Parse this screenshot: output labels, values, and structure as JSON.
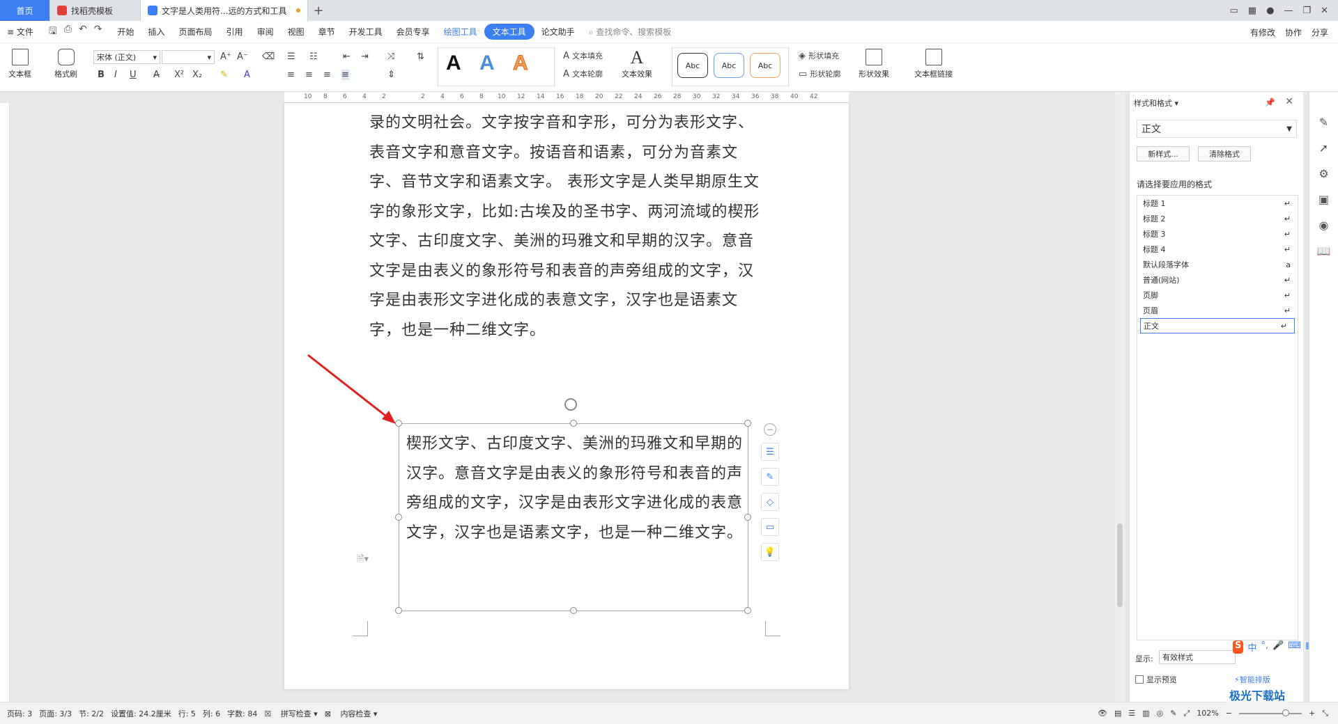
{
  "tabs": [
    {
      "label": "首页"
    },
    {
      "label": "找稻壳模板"
    },
    {
      "label": "文字是人类用符...远的方式和工具"
    }
  ],
  "menu": {
    "file": "文件",
    "items": [
      "开始",
      "插入",
      "页面布局",
      "引用",
      "审阅",
      "视图",
      "章节",
      "开发工具",
      "会员专享",
      "绘图工具",
      "文本工具",
      "论文助手"
    ],
    "search": "查找命令、搜索模板",
    "right": [
      "有修改",
      "协作",
      "分享"
    ]
  },
  "ribbon": {
    "textbox": "文本框",
    "format_painter": "格式刷",
    "font_name": "宋体 (正文)",
    "font_size": "",
    "text_fill": "文本填充",
    "text_outline": "文本轮廓",
    "text_effect": "文本效果",
    "shape_fill": "形状填充",
    "shape_outline": "形状轮廓",
    "shape_effect": "形状效果",
    "textbox_link": "文本框链接",
    "abc": [
      "Abc",
      "Abc",
      "Abc"
    ],
    "bigA": [
      "A",
      "A",
      "A"
    ]
  },
  "ruler_top": [
    "10",
    "8",
    "6",
    "4",
    "2",
    "",
    "2",
    "4",
    "6",
    "8",
    "10",
    "12",
    "14",
    "16",
    "18",
    "20",
    "22",
    "24",
    "26",
    "28",
    "30",
    "32",
    "34",
    "36",
    "38",
    "40",
    "42"
  ],
  "doc": {
    "body": "录的文明社会。文字按字音和字形，可分为表形文字、表音文字和意音文字。按语音和语素，可分为音素文字、音节文字和语素文字。 表形文字是人类早期原生文字的象形文字，比如:古埃及的圣书字、两河流域的楔形文字、古印度文字、美洲的玛雅文和早期的汉字。意音文字是由表义的象形符号和表音的声旁组成的文字，汉字是由表形文字进化成的表意文字，汉字也是语素文字，也是一种二维文字。",
    "textbox": "楔形文字、古印度文字、美洲的玛雅文和早期的汉字。意音文字是由表义的象形符号和表音的声旁组成的文字，汉字是由表形文字进化成的表意文字，汉字也是语素文字，也是一种二维文字。"
  },
  "panel": {
    "title": "样式和格式",
    "current": "正文",
    "new_style": "新样式...",
    "clear_format": "清除格式",
    "choose_label": "请选择要应用的格式",
    "styles": [
      "标题 1",
      "标题 2",
      "标题 3",
      "标题 4",
      "默认段落字体",
      "普通(网站)",
      "页脚",
      "页眉",
      "正文"
    ],
    "show_label": "显示:",
    "show_value": "有效样式",
    "preview": "显示预览",
    "smart": "智能排版"
  },
  "status": {
    "page_num": "页码: 3",
    "pages": "页面: 3/3",
    "section": "节: 2/2",
    "setting": "设置值: 24.2厘米",
    "row": "行: 5",
    "col": "列: 6",
    "words": "字数: 84",
    "spell": "拼写检查",
    "content": "内容检查",
    "zoom": "102%"
  },
  "watermark": "极光下载站"
}
